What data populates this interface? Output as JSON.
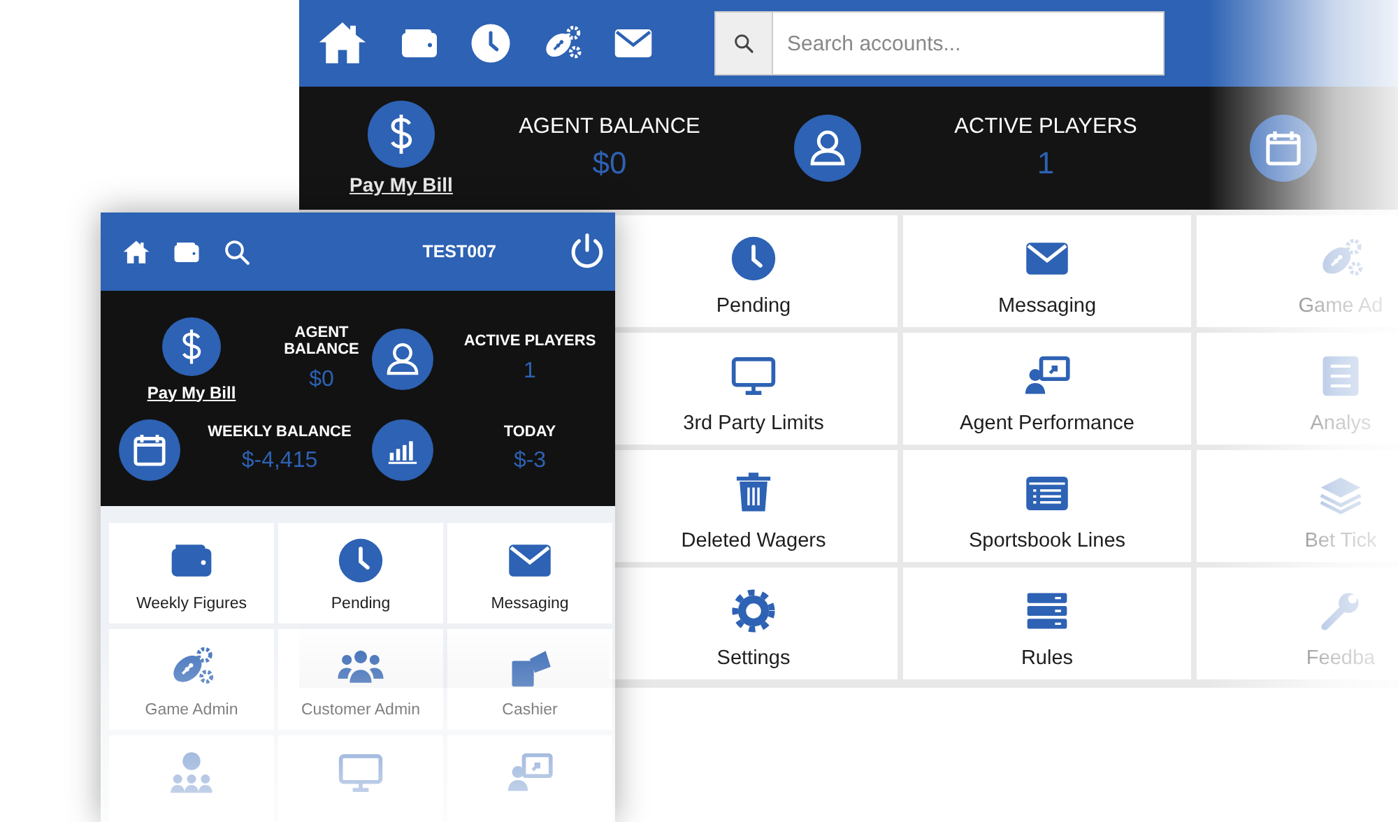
{
  "desktop": {
    "search": {
      "placeholder": "Search accounts..."
    },
    "pay_link": "Pay My Bill",
    "stats": [
      {
        "label": "AGENT BALANCE",
        "value": "$0"
      },
      {
        "label": "ACTIVE PLAYERS",
        "value": "1"
      }
    ],
    "tile_rows": [
      [
        "Pending",
        "Messaging",
        "Game Ad"
      ],
      [
        "3rd Party Limits",
        "Agent Performance",
        "Analys"
      ],
      [
        "Deleted Wagers",
        "Sportsbook Lines",
        "Bet Tick"
      ],
      [
        "Settings",
        "Rules",
        "Feedba"
      ]
    ]
  },
  "mobile": {
    "username": "TEST007",
    "pay_link": "Pay My Bill",
    "stats": [
      {
        "label": "AGENT BALANCE",
        "value": "$0"
      },
      {
        "label": "ACTIVE PLAYERS",
        "value": "1"
      },
      {
        "label": "WEEKLY BALANCE",
        "value": "$-4,415"
      },
      {
        "label": "TODAY",
        "value": "$-3"
      }
    ],
    "tile_rows": [
      [
        {
          "kind": "labeled",
          "label": "Weekly Figures"
        },
        {
          "kind": "labeled",
          "label": "Pending"
        },
        {
          "kind": "labeled",
          "label": "Messaging"
        }
      ],
      [
        {
          "kind": "labeled",
          "label": "Game Admin"
        },
        {
          "kind": "labeled",
          "label": "Customer Admin"
        },
        {
          "kind": "labeled",
          "label": "Cashier"
        }
      ],
      [
        {
          "kind": "unlabeled"
        },
        {
          "kind": "unlabeled"
        },
        {
          "kind": "unlabeled"
        }
      ]
    ]
  }
}
